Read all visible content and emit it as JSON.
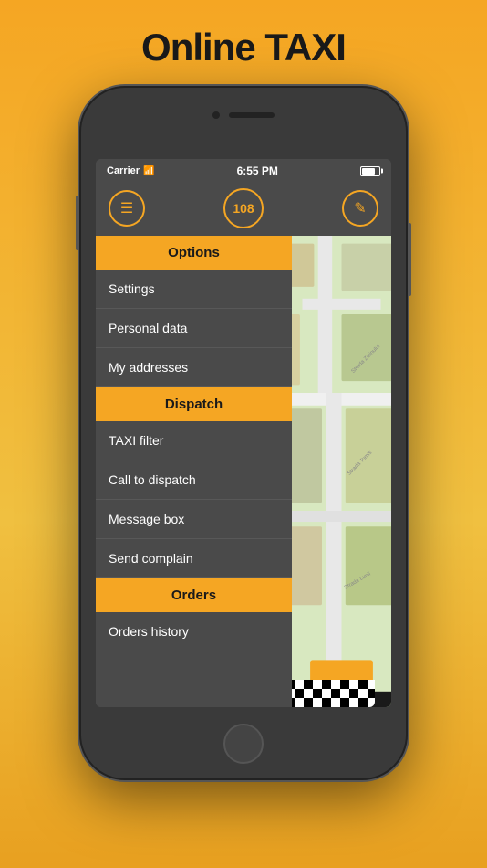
{
  "page": {
    "title": "Online TAXI"
  },
  "status_bar": {
    "carrier": "Carrier",
    "wifi": "WiFi",
    "time": "6:55 PM",
    "battery_label": "Battery"
  },
  "nav": {
    "hamburger_label": "☰",
    "badge_value": "108",
    "edit_label": "✎"
  },
  "menu": {
    "sections": [
      {
        "type": "header",
        "label": "Options"
      },
      {
        "type": "item",
        "label": "Settings"
      },
      {
        "type": "item",
        "label": "Personal data"
      },
      {
        "type": "item",
        "label": "My addresses"
      },
      {
        "type": "header",
        "label": "Dispatch"
      },
      {
        "type": "item",
        "label": "TAXI filter"
      },
      {
        "type": "item",
        "label": "Call to dispatch"
      },
      {
        "type": "item",
        "label": "Message box"
      },
      {
        "type": "item",
        "label": "Send complain"
      },
      {
        "type": "header",
        "label": "Orders"
      },
      {
        "type": "item",
        "label": "Orders history"
      }
    ]
  }
}
